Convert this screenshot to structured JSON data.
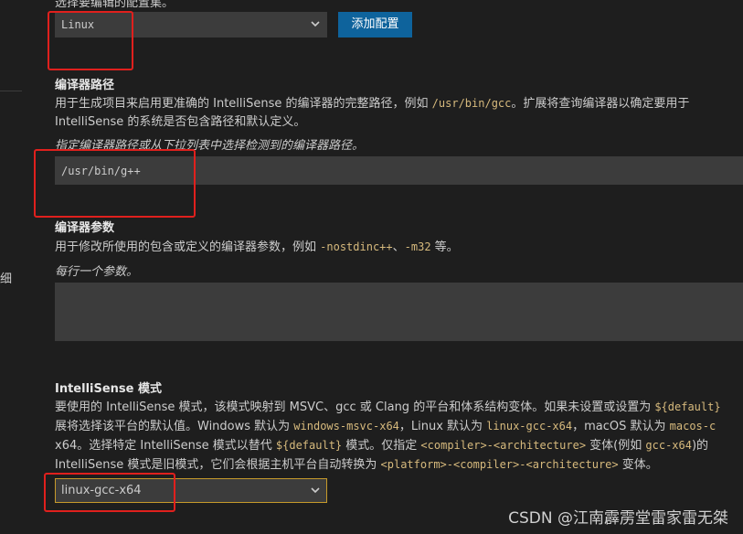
{
  "cut_off_label": "选择要编辑的配置集。",
  "configuration": {
    "selected": "Linux",
    "add_button": "添加配置"
  },
  "left_sidebar": {
    "partial_label": "细"
  },
  "compiler_path": {
    "title": "编译器路径",
    "desc_line1_pre": "用于生成项目来启用更准确的 IntelliSense 的编译器的完整路径，例如 ",
    "desc_line1_code": "/usr/bin/gcc",
    "desc_line1_post": "。扩展将查询编译器以确定要用于",
    "desc_line2": "IntelliSense 的系统是否包含路径和默认定义。",
    "hint": "指定编译器路径或从下拉列表中选择检测到的编译器路径。",
    "value": "/usr/bin/g++"
  },
  "compiler_args": {
    "title": "编译器参数",
    "desc_pre": "用于修改所使用的包含或定义的编译器参数，例如 ",
    "code1": "-nostdinc++",
    "sep": "、",
    "code2": "-m32",
    "desc_post": " 等。",
    "hint": "每行一个参数。",
    "value": ""
  },
  "intellisense_mode": {
    "title": "IntelliSense 模式",
    "l1_pre": "要使用的 IntelliSense 模式，该模式映射到 MSVC、gcc 或 Clang 的平台和体系结构变体。如果未设置或设置为 ",
    "l1_code": "${default}",
    "l2_a": "展将选择该平台的默认值。Windows 默认为 ",
    "l2_code1": "windows-msvc-x64",
    "l2_b": "，Linux 默认为 ",
    "l2_code2": "linux-gcc-x64",
    "l2_c": "，macOS 默认为 ",
    "l2_code3": "macos-c",
    "l3_a": "x64。选择特定 IntelliSense 模式以替代 ",
    "l3_code1": "${default}",
    "l3_b": " 模式。仅指定 ",
    "l3_code2": "<compiler>-<architecture>",
    "l3_c": " 变体(例如 ",
    "l3_code3": "gcc-x64",
    "l3_d": ")的",
    "l4_a": "IntelliSense 模式是旧模式，它们会根据主机平台自动转换为 ",
    "l4_code": "<platform>-<compiler>-<architecture>",
    "l4_b": " 变体。",
    "selected": "linux-gcc-x64"
  },
  "watermark": "CSDN @江南霹雳堂雷家雷无桀",
  "colors": {
    "background": "#1e1e1e",
    "button": "#0e639c",
    "code": "#d7ba7d",
    "annotation": "#e0201d",
    "focus": "#c69a2b"
  }
}
